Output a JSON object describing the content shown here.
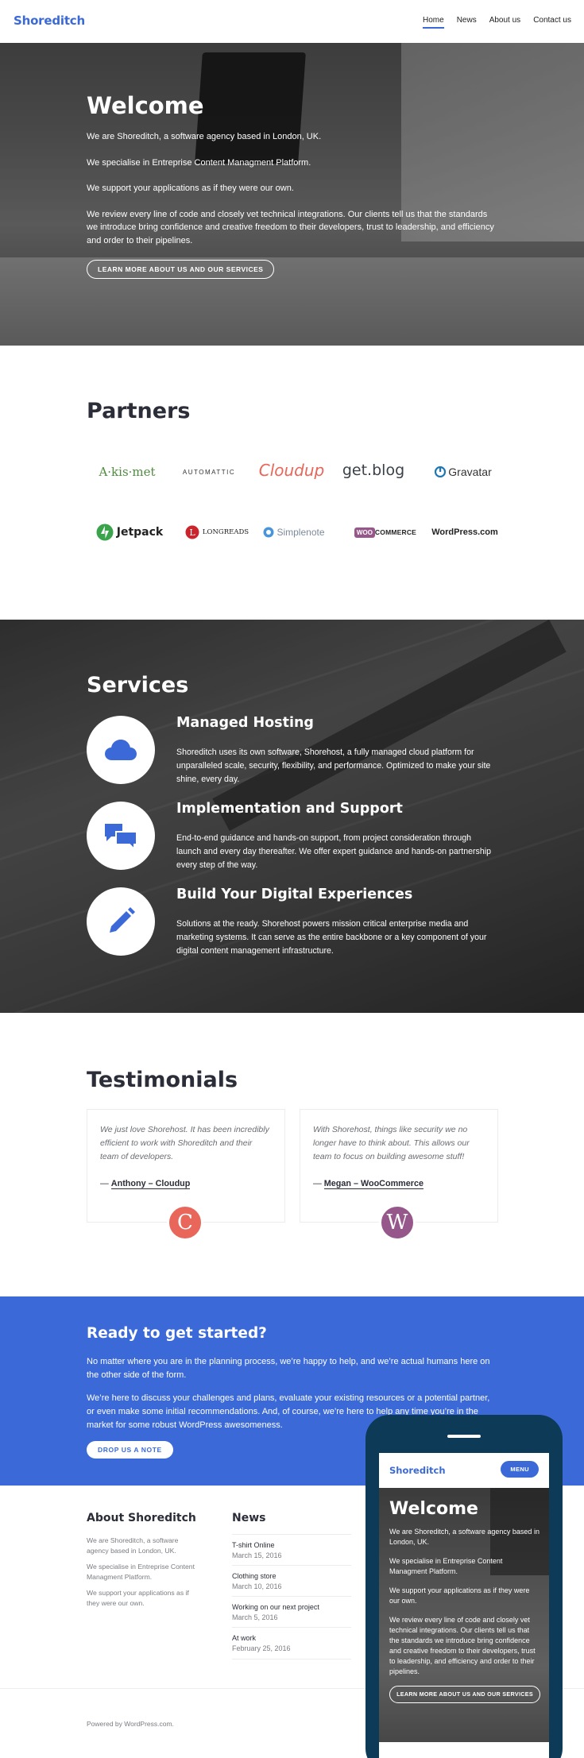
{
  "header": {
    "brand": "Shoreditch",
    "nav": [
      "Home",
      "News",
      "About us",
      "Contact us"
    ]
  },
  "hero": {
    "title": "Welcome",
    "paragraphs": [
      "We are Shoreditch, a software agency based in London, UK.",
      "We specialise in Entreprise Content Managment Platform.",
      "We support your applications as if they were our own.",
      "We review every line of code and closely vet technical integrations. Our clients tell us that the standards we introduce bring confidence and creative freedom to their developers, trust to leadership, and efficiency and order to their pipelines."
    ],
    "button": "LEARN MORE ABOUT US AND OUR SERVICES"
  },
  "partners": {
    "title": "Partners",
    "logos": [
      "A·kis·met",
      "AUTOMATTIC",
      "Cloudup",
      "get.blog",
      "Gravatar",
      "Jetpack",
      "LONGREADS",
      "Simplenote",
      "WOOCOMMERCE",
      "WordPress.com"
    ]
  },
  "services": {
    "title": "Services",
    "items": [
      {
        "title": "Managed Hosting",
        "desc": "Shoreditch uses its own software, Shorehost, a fully managed cloud platform for unparalleled scale, security, flexibility, and performance. Optimized to make your site shine, every day.",
        "icon": "cloud-icon"
      },
      {
        "title": "Implementation and Support",
        "desc": "End-to-end guidance and hands-on support, from project consideration through launch and every day thereafter. We offer expert guidance and hands-on partnership every step of the way.",
        "icon": "chat-bubbles-icon"
      },
      {
        "title": "Build Your Digital Experiences",
        "desc": "Solutions at the ready. Shorehost powers mission critical enterprise media and marketing systems. It can serve as the entire backbone or a key component of your digital content management infrastructure.",
        "icon": "pencil-icon"
      }
    ]
  },
  "testimonials": {
    "title": "Testimonials",
    "items": [
      {
        "quote": "We just love Shorehost. It has been incredibly efficient to work with Shoreditch and their team of developers.",
        "author": "Anthony – Cloudup",
        "avatar": "C"
      },
      {
        "quote": "With Shorehost, things like security we no longer have to think about. This allows our team to focus on building awesome stuff!",
        "author": "Megan – WooCommerce",
        "avatar": "W"
      }
    ]
  },
  "cta": {
    "title": "Ready to get started?",
    "p1": "No matter where you are in the planning process, we’re happy to help, and we’re actual humans here on the other side of the form.",
    "p2": "We’re here to discuss your challenges and plans, evaluate your existing resources or a potential partner, or even make some initial recommendations. And, of course, we’re here to help any time you’re in the market for some robust WordPress awesomeness.",
    "button": "DROP US A NOTE"
  },
  "footer": {
    "about_title": "About Shoreditch",
    "about": [
      "We are Shoreditch, a software agency based in London, UK.",
      "We specialise in Entreprise Content Managment Platform.",
      "We support your applications as if they were our own."
    ],
    "news_title": "News",
    "news": [
      {
        "title": "T-shirt Online",
        "date": "March 15, 2016"
      },
      {
        "title": "Clothing store",
        "date": "March 10, 2016"
      },
      {
        "title": "Working on our next project",
        "date": "March 5, 2016"
      },
      {
        "title": "At work",
        "date": "February 25, 2016"
      }
    ],
    "powered": "Powered by WordPress.com."
  },
  "phone": {
    "brand": "Shoreditch",
    "menu": "MENU",
    "title": "Welcome",
    "paragraphs": [
      "We are Shoreditch, a software agency based in London, UK.",
      "We specialise in Entreprise Content Managment Platform.",
      "We support your applications as if they were our own.",
      "We review every line of code and closely vet technical integrations. Our clients tell us that the standards we introduce bring confidence and creative freedom to their developers, trust to leadership, and efficiency and order to their pipelines."
    ],
    "button": "LEARN MORE ABOUT US AND OUR SERVICES"
  },
  "colors": {
    "accent": "#3b6ad8",
    "dark": "#2b2d38",
    "phone": "#0c3a57"
  }
}
